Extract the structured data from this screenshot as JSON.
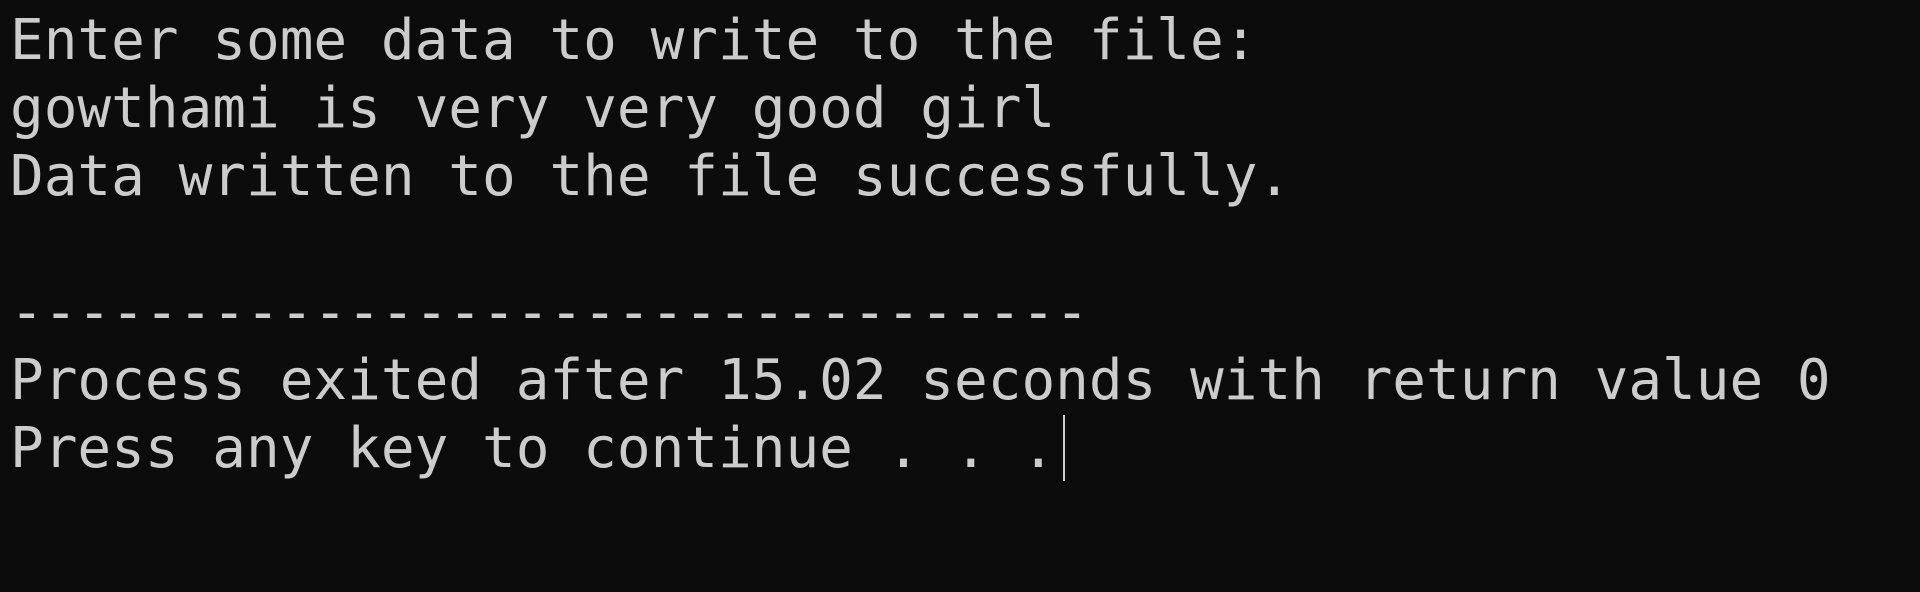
{
  "console": {
    "lines": [
      "Enter some data to write to the file:",
      "gowthami is very very good girl",
      "Data written to the file successfully.",
      "",
      "--------------------------------",
      "Process exited after 15.02 seconds with return value 0",
      "Press any key to continue . . ."
    ]
  },
  "colors": {
    "background": "#0c0c0c",
    "text": "#cccccc"
  }
}
